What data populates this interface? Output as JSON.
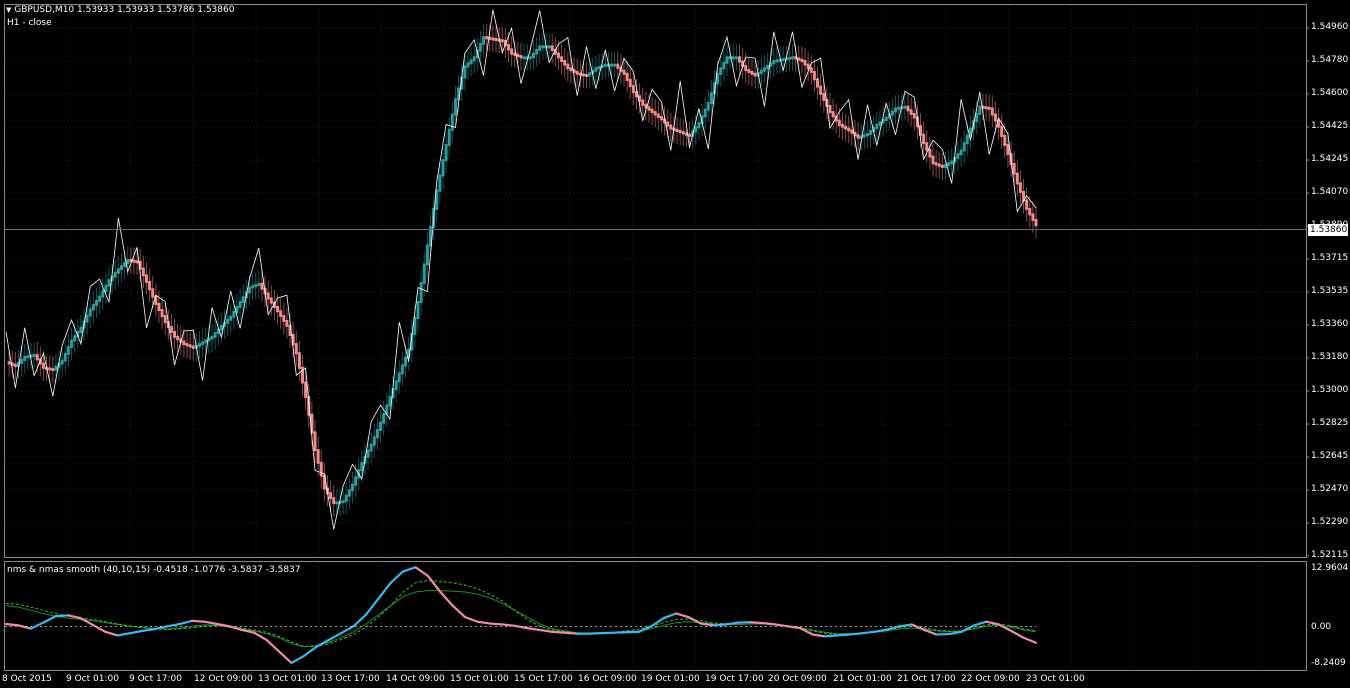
{
  "main_chart": {
    "header": {
      "symbol_line": "GBPUSD,M10  1.53933 1.53933 1.53786 1.53860",
      "overlay_label": "H1 - close"
    },
    "current_price": "1.53860",
    "price_axis_labels": [
      "1.54960",
      "1.54780",
      "1.54600",
      "1.54425",
      "1.54245",
      "1.54070",
      "1.53890",
      "1.53715",
      "1.53535",
      "1.53360",
      "1.53180",
      "1.53000",
      "1.52825",
      "1.52645",
      "1.52470",
      "1.52290",
      "1.52115"
    ]
  },
  "sub_chart": {
    "header": "nms & nmas smooth (40,10,15) -0.4518 -1.0776 -3.5837 -3.5837",
    "axis_labels": [
      "12.9604",
      "0.00",
      "-8.2409"
    ]
  },
  "time_axis_labels": [
    "8 Oct 2015",
    "9 Oct 01:00",
    "9 Oct 17:00",
    "12 Oct 09:00",
    "13 Oct 01:00",
    "13 Oct 17:00",
    "14 Oct 09:00",
    "15 Oct 01:00",
    "15 Oct 17:00",
    "16 Oct 09:00",
    "19 Oct 01:00",
    "19 Oct 17:00",
    "20 Oct 09:00",
    "21 Oct 01:00",
    "21 Oct 17:00",
    "22 Oct 09:00",
    "23 Oct 01:00"
  ],
  "chart_data": [
    {
      "type": "line",
      "ylim": [
        1.5205,
        1.5505
      ],
      "colors": {
        "up": "#2a9d9d",
        "down": "#f08c8c",
        "close_line": "#ffffff",
        "grid": "#2a2a2a"
      },
      "series": [
        {
          "values": [
            1.5311,
            1.5309,
            1.5314,
            1.5315,
            1.5308,
            1.5307,
            1.5312,
            1.5323,
            1.533,
            1.534,
            1.5347,
            1.5356,
            1.5362,
            1.5367,
            1.5366,
            1.5355,
            1.5343,
            1.5333,
            1.5325,
            1.5321,
            1.5319,
            1.5322,
            1.5325,
            1.5331,
            1.5336,
            1.5344,
            1.5352,
            1.5354,
            1.5346,
            1.5339,
            1.5331,
            1.5316,
            1.5292,
            1.5263,
            1.5242,
            1.5234,
            1.5235,
            1.5244,
            1.5256,
            1.5266,
            1.5278,
            1.5292,
            1.5305,
            1.5318,
            1.5344,
            1.5375,
            1.5405,
            1.543,
            1.5455,
            1.5473,
            1.5478,
            1.5489,
            1.5488,
            1.5487,
            1.548,
            1.5478,
            1.5478,
            1.5484,
            1.5484,
            1.5478,
            1.5472,
            1.5469,
            1.5468,
            1.5472,
            1.5474,
            1.5474,
            1.5469,
            1.5459,
            1.5452,
            1.5448,
            1.5444,
            1.5439,
            1.5437,
            1.5435,
            1.5442,
            1.5453,
            1.5469,
            1.5478,
            1.5478,
            1.5471,
            1.5468,
            1.5472,
            1.5476,
            1.5477,
            1.5478,
            1.5476,
            1.547,
            1.5458,
            1.5448,
            1.5441,
            1.5438,
            1.5434,
            1.5436,
            1.5441,
            1.5445,
            1.545,
            1.5451,
            1.5445,
            1.5431,
            1.542,
            1.5418,
            1.5421,
            1.5427,
            1.5439,
            1.5451,
            1.545,
            1.544,
            1.5425,
            1.5409,
            1.5395,
            1.5386
          ]
        }
      ]
    },
    {
      "type": "line",
      "ylim": [
        -8.2409,
        12.9604
      ],
      "colors": {
        "up": "#3ab8f0",
        "down": "#f08caa",
        "signal_solid": "#1f8f1f",
        "signal_dashed": "#2fbf2f",
        "zero_line": "#ffffff"
      },
      "series": [
        {
          "values": [
            0.5,
            0.2,
            -0.5,
            0.8,
            2.2,
            2.4,
            1.8,
            0.3,
            -1.2,
            -2.0,
            -1.5,
            -1.0,
            -0.6,
            0.0,
            0.5,
            1.2,
            1.0,
            0.5,
            0.0,
            -0.8,
            -1.4,
            -3.0,
            -5.5,
            -8.0,
            -6.5,
            -4.5,
            -3.0,
            -1.5,
            0.0,
            2.5,
            6.0,
            9.5,
            12.0,
            12.9,
            11.0,
            7.5,
            4.5,
            2.0,
            1.0,
            0.6,
            0.4,
            0.1,
            -0.4,
            -0.8,
            -1.2,
            -1.4,
            -1.6,
            -1.6,
            -1.5,
            -1.4,
            -1.3,
            -1.2,
            0.0,
            1.8,
            2.8,
            2.0,
            0.6,
            0.2,
            0.4,
            0.8,
            0.9,
            0.7,
            0.4,
            0.0,
            -0.4,
            -1.8,
            -2.2,
            -2.0,
            -1.8,
            -1.5,
            -1.2,
            -0.7,
            0.0,
            0.4,
            -0.8,
            -1.8,
            -1.7,
            -1.2,
            0.2,
            1.0,
            0.4,
            -1.0,
            -2.5,
            -3.6
          ]
        },
        {
          "values": [
            4.5,
            4.2,
            3.5,
            2.8,
            2.2,
            1.8,
            1.5,
            1.2,
            0.8,
            0.4,
            0.0,
            -0.3,
            -0.5,
            -0.6,
            -0.4,
            0.0,
            0.3,
            0.2,
            -0.2,
            -0.6,
            -1.0,
            -1.6,
            -2.5,
            -3.8,
            -4.5,
            -4.2,
            -3.5,
            -2.5,
            -1.2,
            0.5,
            2.5,
            4.5,
            6.5,
            7.5,
            7.8,
            7.8,
            7.7,
            7.5,
            7.0,
            6.2,
            5.0,
            3.5,
            2.0,
            0.5,
            -0.5,
            -1.0,
            -1.4,
            -1.5,
            -1.5,
            -1.4,
            -1.2,
            -1.0,
            -0.5,
            0.2,
            0.8,
            1.0,
            0.8,
            0.5,
            0.4,
            0.4,
            0.5,
            0.5,
            0.3,
            0.0,
            -0.3,
            -0.8,
            -1.3,
            -1.6,
            -1.6,
            -1.5,
            -1.3,
            -1.0,
            -0.6,
            -0.4,
            -0.6,
            -1.0,
            -1.2,
            -1.1,
            -0.6,
            0.0,
            0.2,
            -0.2,
            -0.8,
            -1.2
          ]
        },
        {
          "values": [
            5.0,
            4.8,
            4.2,
            3.5,
            2.8,
            2.2,
            1.8,
            1.5,
            1.0,
            0.5,
            0.1,
            -0.2,
            -0.5,
            -0.7,
            -0.6,
            -0.3,
            0.0,
            0.2,
            0.0,
            -0.4,
            -0.8,
            -1.3,
            -2.2,
            -3.4,
            -4.4,
            -4.4,
            -3.8,
            -2.9,
            -1.8,
            -0.2,
            2.0,
            4.5,
            7.5,
            9.5,
            10.0,
            9.8,
            9.5,
            9.0,
            8.2,
            7.0,
            5.5,
            3.5,
            1.5,
            0.0,
            -0.8,
            -1.2,
            -1.5,
            -1.6,
            -1.5,
            -1.3,
            -1.0,
            -0.6,
            0.0,
            0.8,
            1.5,
            1.6,
            1.2,
            0.7,
            0.6,
            0.7,
            0.8,
            0.7,
            0.4,
            0.0,
            -0.4,
            -1.0,
            -1.5,
            -1.8,
            -1.7,
            -1.5,
            -1.2,
            -0.8,
            -0.3,
            0.0,
            -0.3,
            -0.8,
            -1.1,
            -1.0,
            -0.4,
            0.3,
            0.5,
            0.1,
            -0.6,
            -1.0
          ]
        }
      ]
    }
  ]
}
